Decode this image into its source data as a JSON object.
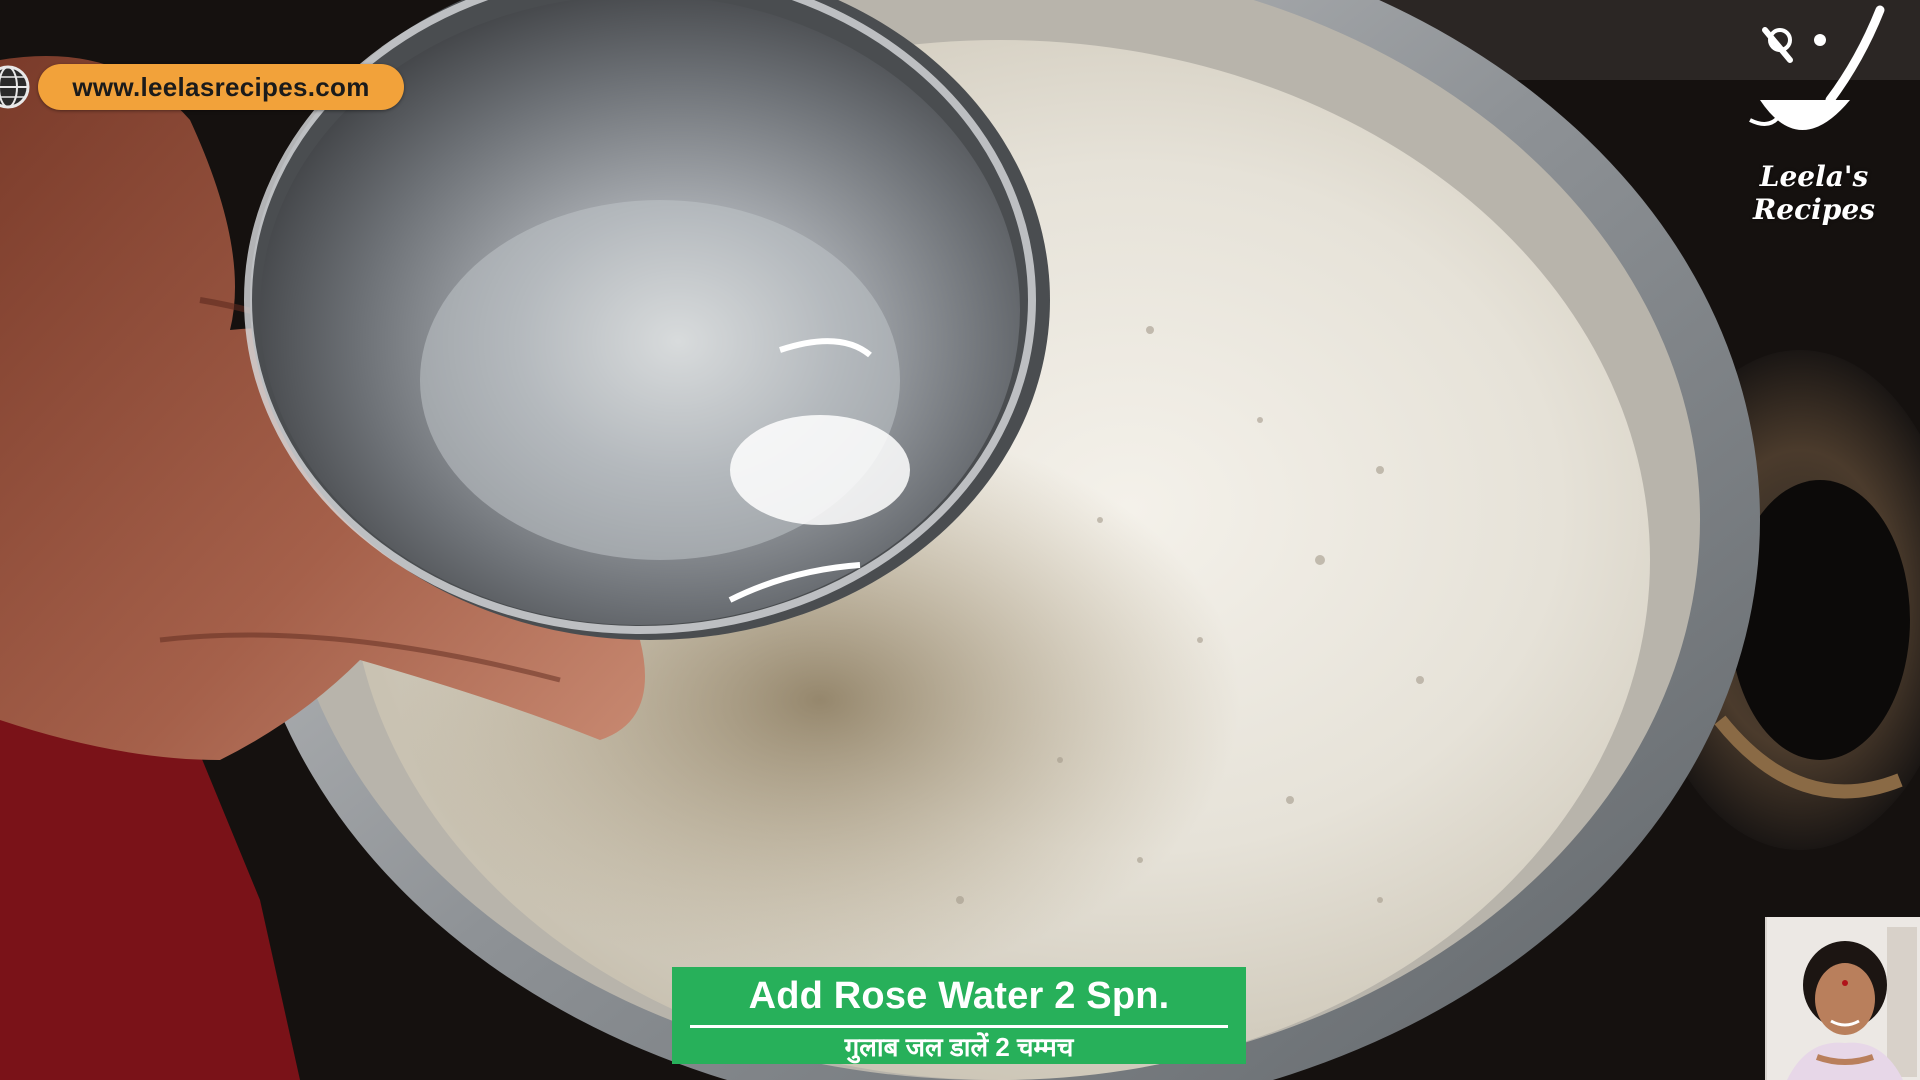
{
  "watermark": {
    "url_text": "www.leelasrecipes.com",
    "icon": "globe-icon"
  },
  "logo": {
    "text": "Leela's Recipes",
    "icon": "ladle-logo-icon"
  },
  "caption": {
    "english": "Add Rose Water 2 Spn.",
    "hindi": "गुलाब जल डालें 2 चम्मच",
    "background_color": "#27b05a"
  },
  "presenter_inset": {
    "description_icon": "presenter-webcam"
  }
}
